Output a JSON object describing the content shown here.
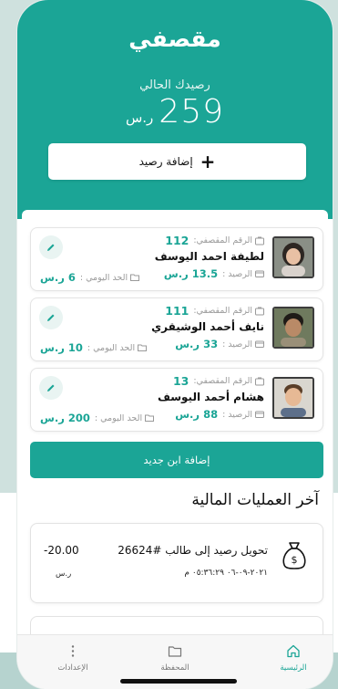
{
  "header": {
    "app_title": "مقصفي",
    "balance_label": "رصيدك الحالي",
    "balance_amount": "259",
    "balance_currency": "ر.س",
    "add_balance_label": "إضافة رصيد"
  },
  "children": [
    {
      "pocket_label": "الرقم المقصفي:",
      "pocket_number": "112",
      "name": "لطيفة احمد اليوسف",
      "balance_label": "الرصيد :",
      "balance_value": "13.5 ر.س",
      "daily_label": "الحد اليومي :",
      "daily_value": "6 ر.س"
    },
    {
      "pocket_label": "الرقم المقصفي:",
      "pocket_number": "111",
      "name": "نايف أحمد الوشيقري",
      "balance_label": "الرصيد :",
      "balance_value": "33 ر.س",
      "daily_label": "الحد اليومي :",
      "daily_value": "10 ر.س"
    },
    {
      "pocket_label": "الرقم المقصفي:",
      "pocket_number": "13",
      "name": "هشام أحمد اليوسف",
      "balance_label": "الرصيد :",
      "balance_value": "88 ر.س",
      "daily_label": "الحد اليومي :",
      "daily_value": "200 ر.س"
    }
  ],
  "add_child_label": "إضافة ابن جديد",
  "transactions": {
    "title": "آخر العمليات المالية",
    "items": [
      {
        "title": "تحويل رصيد إلى طالب #26624",
        "date": "٢٠٢١-٠٩-٠٦ ٠٥:٣٦:٢٩ م",
        "amount": "-20.00",
        "currency": "ر.س"
      }
    ]
  },
  "nav": {
    "home": "الرئيسية",
    "wallet": "المحفظة",
    "settings": "الإعدادات"
  },
  "colors": {
    "accent": "#1ba596",
    "background": "#cfe1de"
  }
}
